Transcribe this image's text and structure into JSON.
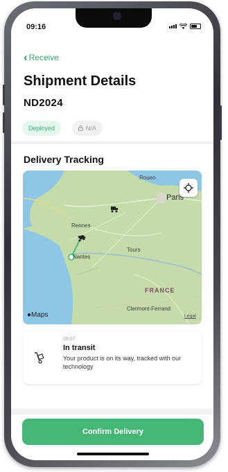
{
  "status_bar": {
    "time": "09:16"
  },
  "nav": {
    "back_label": "Receive"
  },
  "shipment": {
    "title": "Shipment Details",
    "code": "ND2024",
    "status_badge": "Deployed",
    "na_badge": "N/A"
  },
  "tracking": {
    "section_title": "Delivery Tracking",
    "map": {
      "cities": {
        "rouen": "Rouen",
        "paris": "Paris",
        "rennes": "Rennes",
        "nantes": "Nantes",
        "tours": "Tours",
        "clermont": "Clermont-Ferrand"
      },
      "country": "FRANCE",
      "logo": "Maps",
      "legal": "Legal"
    },
    "event": {
      "time": "09:07",
      "title": "In transit",
      "description": "Your product is on its way, tracked with our technology"
    }
  },
  "footer": {
    "confirm_label": "Confirm Delivery"
  },
  "colors": {
    "accent": "#46b675",
    "link": "#2fae6a"
  },
  "icons": [
    "chevron-left-icon",
    "locate-icon",
    "apple-icon",
    "vehicle-icon",
    "hand-truck-icon",
    "wifi-icon",
    "battery-icon",
    "signal-icon"
  ]
}
